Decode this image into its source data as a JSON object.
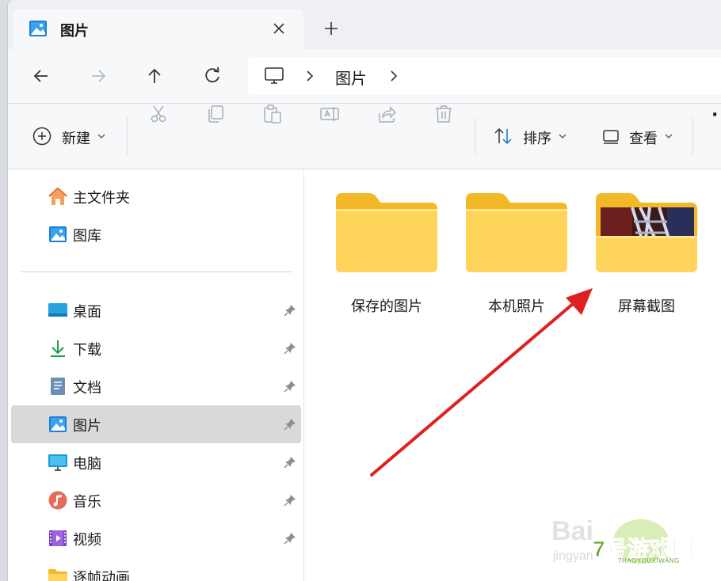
{
  "tab": {
    "title": "图片",
    "icon": "pictures-icon",
    "close_icon": "close-icon"
  },
  "new_tab_icon": "plus-icon",
  "nav": {
    "back_icon": "arrow-left-icon",
    "forward_icon": "arrow-right-icon",
    "up_icon": "arrow-up-icon",
    "refresh_icon": "refresh-icon"
  },
  "address": {
    "root_icon": "this-pc-icon",
    "crumb": "图片"
  },
  "toolbar": {
    "new_label": "新建",
    "sort_label": "排序",
    "view_label": "查看",
    "more_label": "·"
  },
  "sidebar": {
    "top": [
      {
        "label": "主文件夹",
        "icon": "home-icon"
      },
      {
        "label": "图库",
        "icon": "gallery-icon"
      }
    ],
    "pinned": [
      {
        "label": "桌面",
        "icon": "desktop-icon"
      },
      {
        "label": "下载",
        "icon": "download-icon"
      },
      {
        "label": "文档",
        "icon": "document-icon"
      },
      {
        "label": "图片",
        "icon": "pictures-icon",
        "selected": true
      },
      {
        "label": "电脑",
        "icon": "monitor-icon"
      },
      {
        "label": "音乐",
        "icon": "music-icon"
      },
      {
        "label": "视频",
        "icon": "video-icon"
      },
      {
        "label": "逐帧动画",
        "icon": "folder-icon"
      }
    ]
  },
  "folders": [
    {
      "label": "保存的图片"
    },
    {
      "label": "本机照片"
    },
    {
      "label": "屏幕截图",
      "has_thumbnail": true
    }
  ],
  "colors": {
    "accent": "#0067c0",
    "folder_yellow": "#ffd45a",
    "folder_tab": "#f3b828",
    "selected_bg": "#d9d9d9",
    "arrow_red": "#e02020"
  },
  "watermark": {
    "baidu": "Bai",
    "jingyan": "jingyan",
    "site": "7号游戏网",
    "site_pinyin": "7HAOYOUXIWANG"
  }
}
